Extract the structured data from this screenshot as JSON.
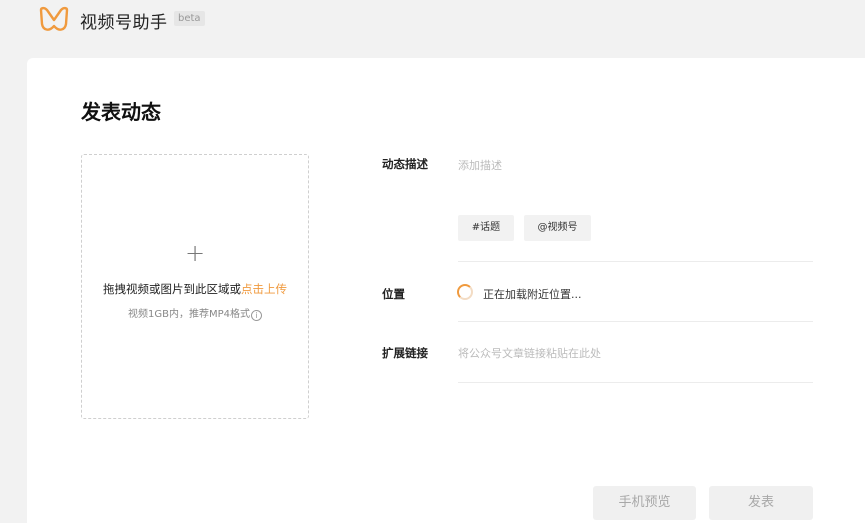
{
  "header": {
    "logo_icon": "wechat-channels-logo-icon",
    "app_title": "视频号助手",
    "beta_badge": "beta"
  },
  "page": {
    "title": "发表动态"
  },
  "upload": {
    "plus_icon": "+",
    "drag_text": "拖拽视频或图片到此区域或",
    "upload_link": "点击上传",
    "hint": "视频1GB内，推荐MP4格式",
    "info_icon": "i"
  },
  "form": {
    "description": {
      "label": "动态描述",
      "placeholder": "添加描述"
    },
    "tags": {
      "topic": "#话题",
      "mention": "@视频号"
    },
    "location": {
      "label": "位置",
      "loading_text": "正在加载附近位置..."
    },
    "extended_link": {
      "label": "扩展链接",
      "placeholder": "将公众号文章链接粘贴在此处"
    }
  },
  "actions": {
    "preview_label": "手机预览",
    "publish_label": "发表"
  },
  "colors": {
    "accent": "#f09a3e",
    "background": "#f2f2f2",
    "disabled_button": "#f0f0f0"
  }
}
